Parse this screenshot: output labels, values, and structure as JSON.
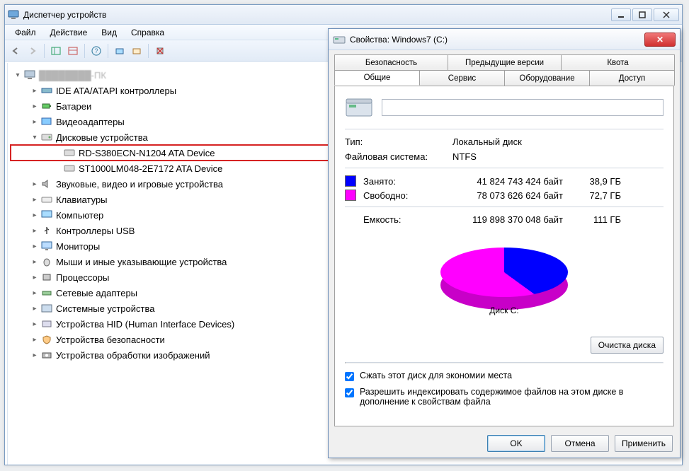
{
  "dm": {
    "title": "Диспетчер устройств",
    "menu": {
      "file": "Файл",
      "action": "Действие",
      "view": "Вид",
      "help": "Справка"
    },
    "tree": {
      "root": "",
      "items": [
        {
          "label": "IDE ATA/ATAPI контроллеры"
        },
        {
          "label": "Батареи"
        },
        {
          "label": "Видеоадаптеры"
        },
        {
          "label": "Дисковые устройства",
          "expanded": true,
          "children": [
            {
              "label": "RD-S380ECN-N1204 ATA Device",
              "highlighted": true
            },
            {
              "label": "ST1000LM048-2E7172 ATA Device"
            }
          ]
        },
        {
          "label": "Звуковые, видео и игровые устройства"
        },
        {
          "label": "Клавиатуры"
        },
        {
          "label": "Компьютер"
        },
        {
          "label": "Контроллеры USB"
        },
        {
          "label": "Мониторы"
        },
        {
          "label": "Мыши и иные указывающие устройства"
        },
        {
          "label": "Процессоры"
        },
        {
          "label": "Сетевые адаптеры"
        },
        {
          "label": "Системные устройства"
        },
        {
          "label": "Устройства HID (Human Interface Devices)"
        },
        {
          "label": "Устройства безопасности"
        },
        {
          "label": "Устройства обработки изображений"
        }
      ]
    }
  },
  "props": {
    "title": "Свойства: Windows7 (C:)",
    "tabs_top": {
      "security": "Безопасность",
      "prev": "Предыдущие версии",
      "quota": "Квота"
    },
    "tabs_bottom": {
      "general": "Общие",
      "service": "Сервис",
      "hardware": "Оборудование",
      "sharing": "Доступ"
    },
    "drive_name": "",
    "type_label": "Тип:",
    "type_value": "Локальный диск",
    "fs_label": "Файловая система:",
    "fs_value": "NTFS",
    "used_label": "Занято:",
    "used_bytes": "41 824 743 424 байт",
    "used_human": "38,9 ГБ",
    "free_label": "Свободно:",
    "free_bytes": "78 073 626 624 байт",
    "free_human": "72,7 ГБ",
    "cap_label": "Емкость:",
    "cap_bytes": "119 898 370 048 байт",
    "cap_human": "111 ГБ",
    "disk_caption": "Диск C:",
    "cleanup": "Очистка диска",
    "compress": "Сжать этот диск для экономии места",
    "index": "Разрешить индексировать содержимое файлов на этом диске в дополнение к свойствам файла",
    "ok": "OK",
    "cancel": "Отмена",
    "apply": "Применить"
  },
  "chart_data": {
    "type": "pie",
    "title": "Диск C:",
    "series": [
      {
        "name": "Занято",
        "value": 41824743424,
        "human": "38,9 ГБ",
        "color": "#0000ff"
      },
      {
        "name": "Свободно",
        "value": 78073626624,
        "human": "72,7 ГБ",
        "color": "#ff00ff"
      }
    ],
    "total": {
      "name": "Емкость",
      "value": 119898370048,
      "human": "111 ГБ"
    }
  }
}
